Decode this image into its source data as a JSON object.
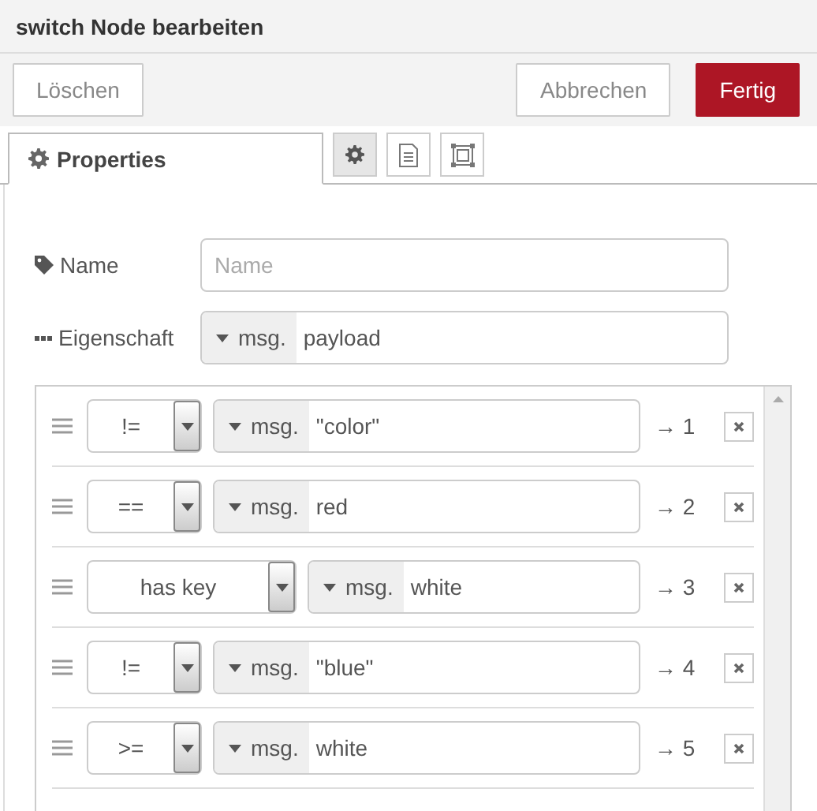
{
  "dialog": {
    "title": "switch Node bearbeiten"
  },
  "buttons": [
    {
      "label": "Löschen",
      "kind": "plain"
    },
    {
      "label": "Abbrechen",
      "kind": "plain"
    },
    {
      "label": "Fertig",
      "kind": "primary"
    }
  ],
  "tabs": [
    {
      "label": "Properties",
      "selected": true
    }
  ],
  "tab_icons": [
    {
      "kind": "gear",
      "selected": true
    },
    {
      "kind": "doc",
      "selected": false
    },
    {
      "kind": "frame",
      "selected": false
    }
  ],
  "name_field": {
    "label": "Name",
    "placeholder": "Name"
  },
  "property_field": {
    "label": "Eigenschaft",
    "type": "msg.",
    "value": "payload"
  },
  "rules": [
    {
      "operator": "!=",
      "type": "msg.",
      "value": "\"color\"",
      "output": "→ 1"
    },
    {
      "operator": "==",
      "type": "msg.",
      "value": "red",
      "output": "→ 2"
    },
    {
      "operator": "has key",
      "type": "msg.",
      "value": "white",
      "output": "→ 3"
    },
    {
      "operator": "!=",
      "type": "msg.",
      "value": "\"blue\"",
      "output": "→ 4"
    },
    {
      "operator": ">=",
      "type": "msg.",
      "value": "white",
      "output": "→ 5"
    }
  ]
}
